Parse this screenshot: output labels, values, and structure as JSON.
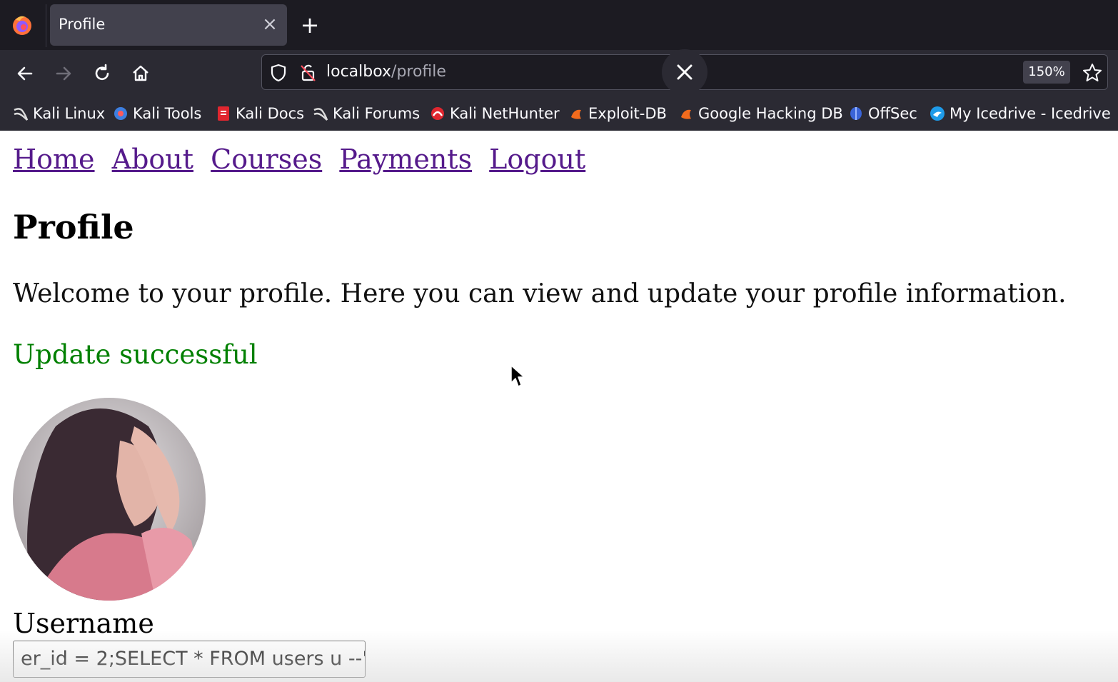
{
  "browser": {
    "tab_title": "Profile",
    "url_host": "localbox",
    "url_path": "/profile",
    "zoom": "150%",
    "bookmarks": [
      "Kali Linux",
      "Kali Tools",
      "Kali Docs",
      "Kali Forums",
      "Kali NetHunter",
      "Exploit-DB",
      "Google Hacking DB",
      "OffSec",
      "My Icedrive - Icedrive"
    ]
  },
  "site": {
    "nav": [
      "Home",
      "About",
      "Courses",
      "Payments",
      "Logout"
    ],
    "title": "Profile",
    "welcome": "Welcome to your profile. Here you can view and update your profile information.",
    "status": "Update successful",
    "username_label": "Username",
    "username_value": "er_id = 2;SELECT * FROM users u --'"
  },
  "colors": {
    "link": "#551a8b",
    "success": "#008000",
    "chrome_bg": "#2b2a33"
  }
}
